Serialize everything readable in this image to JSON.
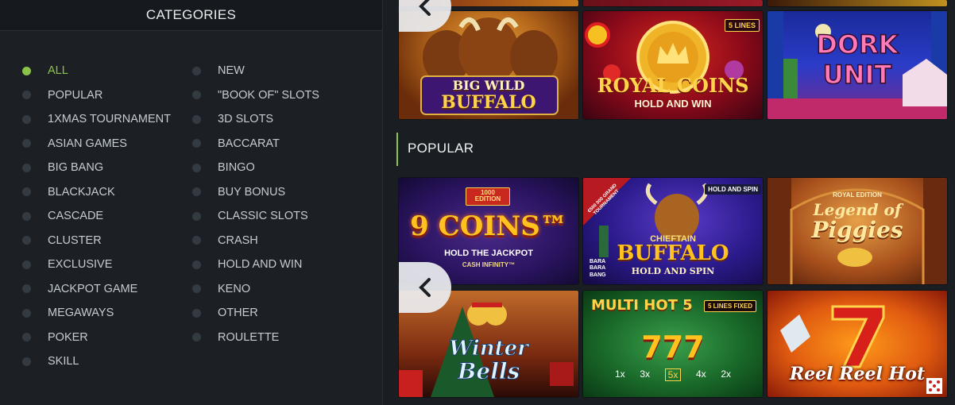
{
  "categories": {
    "title": "CATEGORIES",
    "left": [
      {
        "label": "ALL",
        "active": true
      },
      {
        "label": "POPULAR"
      },
      {
        "label": "1XMAS TOURNAMENT"
      },
      {
        "label": "ASIAN GAMES"
      },
      {
        "label": "BIG BANG"
      },
      {
        "label": "BLACKJACK"
      },
      {
        "label": "CASCADE"
      },
      {
        "label": "CLUSTER"
      },
      {
        "label": "EXCLUSIVE"
      },
      {
        "label": "JACKPOT GAME"
      },
      {
        "label": "MEGAWAYS"
      },
      {
        "label": "POKER"
      },
      {
        "label": "SKILL"
      }
    ],
    "right": [
      {
        "label": "NEW"
      },
      {
        "label": "\"BOOK OF\" SLOTS"
      },
      {
        "label": "3D SLOTS"
      },
      {
        "label": "BACCARAT"
      },
      {
        "label": "BINGO"
      },
      {
        "label": "BUY BONUS"
      },
      {
        "label": "CLASSIC SLOTS"
      },
      {
        "label": "CRASH"
      },
      {
        "label": "HOLD AND WIN"
      },
      {
        "label": "KENO"
      },
      {
        "label": "OTHER"
      },
      {
        "label": "ROULETTE"
      }
    ]
  },
  "top_row": {
    "games": [
      {
        "line1": "BIG WILD",
        "line2": "BUFFALO"
      },
      {
        "line1": "ROYAL COINS",
        "line2": "HOLD AND WIN",
        "badge": "5 LINES"
      },
      {
        "line1": "DORK",
        "line2": "UNIT"
      }
    ]
  },
  "popular": {
    "title": "POPULAR",
    "games": [
      {
        "line1": "9 COINS™",
        "line2": "HOLD THE JACKPOT",
        "line3": "CASH INFINITY™",
        "badge": "1000 EDITION"
      },
      {
        "line1": "CHIEFTAIN",
        "line2": "BUFFALO",
        "line3": "HOLD AND SPIN",
        "badge": "HOLD AND SPIN",
        "ribbon": "€500 000 GRAND TOURNAMENT",
        "studio": "BARA BARA BANG"
      },
      {
        "line1": "Legend of",
        "line2": "Piggies",
        "badge": "ROYAL EDITION"
      },
      {
        "line1": "Winter",
        "line2": "Bells"
      },
      {
        "line1": "MULTI HOT 5",
        "line2": "777",
        "badge": "5 LINES FIXED",
        "multipliers": [
          "1x",
          "3x",
          "5x",
          "4x",
          "2x"
        ]
      },
      {
        "line1": "Reel Reel Hot"
      }
    ]
  },
  "colors": {
    "accent": "#8bc34a",
    "panel_bg": "#1c2024",
    "header_bg": "#161a1e"
  },
  "icons": {
    "nav_prev": "chevron-left-icon"
  }
}
